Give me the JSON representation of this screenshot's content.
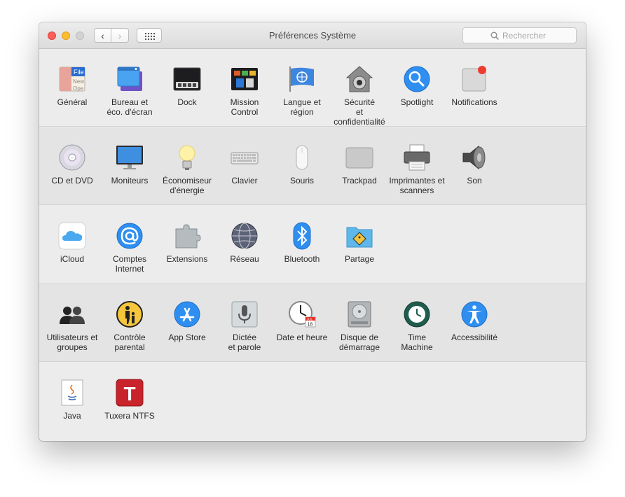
{
  "window": {
    "title": "Préférences Système",
    "search_placeholder": "Rechercher",
    "back_glyph": "‹",
    "forward_glyph": "›"
  },
  "rows": [
    [
      {
        "label": "Général",
        "icon": "general-icon"
      },
      {
        "label": "Bureau et\néco. d'écran",
        "icon": "desktop-screensaver-icon"
      },
      {
        "label": "Dock",
        "icon": "dock-icon"
      },
      {
        "label": "Mission\nControl",
        "icon": "mission-control-icon"
      },
      {
        "label": "Langue et\nrégion",
        "icon": "language-region-icon"
      },
      {
        "label": "Sécurité\net confidentialité",
        "icon": "security-house-icon"
      },
      {
        "label": "Spotlight",
        "icon": "spotlight-magnifier-icon"
      },
      {
        "label": "Notifications",
        "icon": "notifications-icon"
      }
    ],
    [
      {
        "label": "CD et DVD",
        "icon": "cd-dvd-icon"
      },
      {
        "label": "Moniteurs",
        "icon": "monitor-icon"
      },
      {
        "label": "Économiseur\nd'énergie",
        "icon": "lightbulb-icon"
      },
      {
        "label": "Clavier",
        "icon": "keyboard-icon"
      },
      {
        "label": "Souris",
        "icon": "mouse-icon"
      },
      {
        "label": "Trackpad",
        "icon": "trackpad-icon"
      },
      {
        "label": "Imprimantes et\nscanners",
        "icon": "printer-icon"
      },
      {
        "label": "Son",
        "icon": "speaker-icon"
      }
    ],
    [
      {
        "label": "iCloud",
        "icon": "icloud-icon"
      },
      {
        "label": "Comptes\nInternet",
        "icon": "at-sign-icon"
      },
      {
        "label": "Extensions",
        "icon": "puzzle-piece-icon"
      },
      {
        "label": "Réseau",
        "icon": "network-globe-icon"
      },
      {
        "label": "Bluetooth",
        "icon": "bluetooth-icon"
      },
      {
        "label": "Partage",
        "icon": "sharing-folder-icon"
      }
    ],
    [
      {
        "label": "Utilisateurs et\ngroupes",
        "icon": "users-groups-icon"
      },
      {
        "label": "Contrôle\nparental",
        "icon": "parental-controls-icon"
      },
      {
        "label": "App Store",
        "icon": "app-store-icon"
      },
      {
        "label": "Dictée\net parole",
        "icon": "microphone-icon"
      },
      {
        "label": "Date et heure",
        "icon": "clock-calendar-icon"
      },
      {
        "label": "Disque de\ndémarrage",
        "icon": "startup-disk-icon"
      },
      {
        "label": "Time\nMachine",
        "icon": "time-machine-icon"
      },
      {
        "label": "Accessibilité",
        "icon": "accessibility-icon"
      }
    ],
    [
      {
        "label": "Java",
        "icon": "java-icon"
      },
      {
        "label": "Tuxera NTFS",
        "icon": "tuxera-ntfs-icon"
      }
    ]
  ],
  "icon_text": {
    "general_file": "File",
    "general_new": "New",
    "general_ope": "Ope",
    "calendar_month": "JUL",
    "calendar_day": "18",
    "tuxera_letter": "T"
  }
}
